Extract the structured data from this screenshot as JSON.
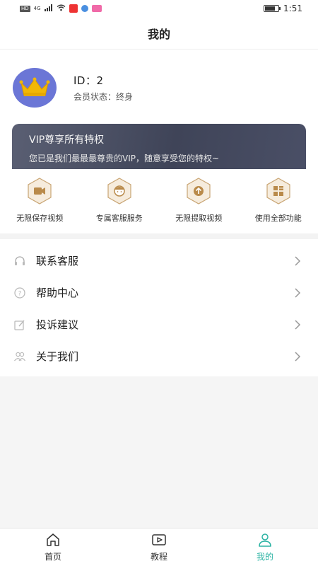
{
  "status_bar": {
    "chip": "HD",
    "network": "4G",
    "time": "1:51",
    "battery_level": 0.8
  },
  "header": {
    "title": "我的"
  },
  "profile": {
    "id_text": "ID：2",
    "member_status": "会员状态：终身",
    "avatar_icon": "crown-icon"
  },
  "vip": {
    "title": "VIP尊享所有特权",
    "subtitle": "您已是我们最最最尊贵的VIP，随意享受您的特权~"
  },
  "features": [
    {
      "label": "无限保存视频",
      "icon": "video-camera-icon"
    },
    {
      "label": "专属客服服务",
      "icon": "service-agent-icon"
    },
    {
      "label": "无限提取视频",
      "icon": "upload-arrow-icon"
    },
    {
      "label": "使用全部功能",
      "icon": "grid-apps-icon"
    }
  ],
  "menu": [
    {
      "label": "联系客服",
      "icon": "headset-icon"
    },
    {
      "label": "帮助中心",
      "icon": "question-icon"
    },
    {
      "label": "投诉建议",
      "icon": "edit-icon"
    },
    {
      "label": "关于我们",
      "icon": "users-icon"
    }
  ],
  "tabs": [
    {
      "label": "首页",
      "icon": "home-icon"
    },
    {
      "label": "教程",
      "icon": "play-icon"
    },
    {
      "label": "我的",
      "icon": "person-icon",
      "active": true
    }
  ],
  "colors": {
    "accent": "#2bb3a3",
    "avatar_bg": "#6b76d6",
    "crown": "#f2b705",
    "vip_card": "#424759",
    "feature_hex": "#f6ecdd",
    "feature_icon": "#b98a4a"
  }
}
